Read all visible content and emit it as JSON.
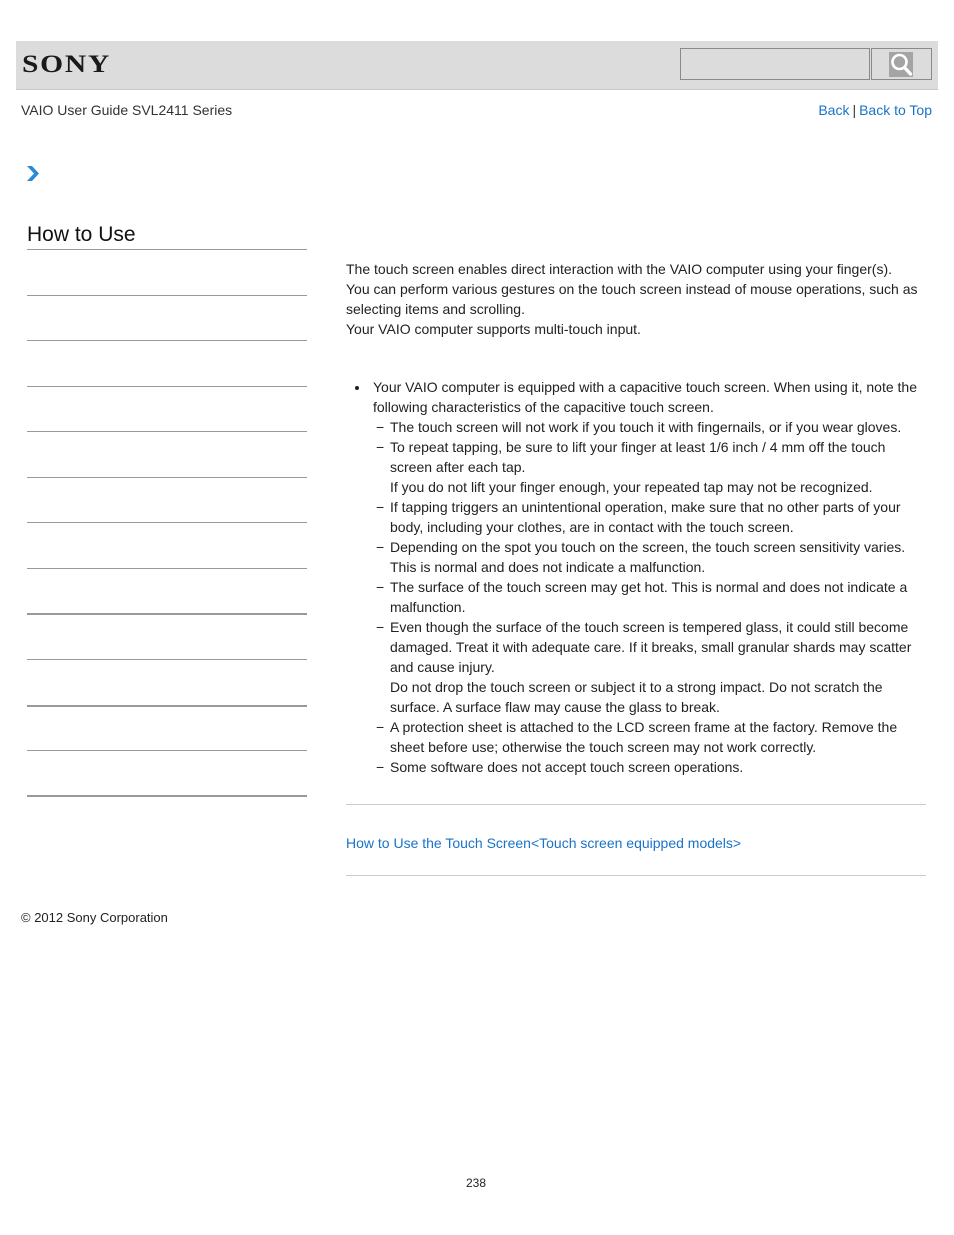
{
  "header": {
    "brand": "SONY",
    "search": {
      "value": "",
      "placeholder": ""
    },
    "search_icon": "magnifier-icon"
  },
  "subheader": {
    "guide_title": "VAIO User Guide SVL2411 Series",
    "back_label": "Back",
    "separator": "|",
    "back_to_top_label": "Back to Top"
  },
  "breadcrumb": {
    "icon": "chevron-right-icon",
    "accent": "#2a8ad4"
  },
  "sidebar": {
    "heading": "How to Use",
    "item_count": 12
  },
  "main": {
    "intro": [
      "The touch screen enables direct interaction with the VAIO computer using your finger(s).",
      "You can perform various gestures on the touch screen instead of mouse operations, such as selecting items and scrolling.",
      "Your VAIO computer supports multi-touch input."
    ],
    "notes": {
      "bullet": "Your VAIO computer is equipped with a capacitive touch screen. When using it, note the following characteristics of the capacitive touch screen.",
      "items": [
        {
          "text": "The touch screen will not work if you touch it with fingernails, or if you wear gloves.",
          "extra": ""
        },
        {
          "text": "To repeat tapping, be sure to lift your finger at least 1/6 inch / 4 mm off the touch screen after each tap.",
          "extra": "If you do not lift your finger enough, your repeated tap may not be recognized."
        },
        {
          "text": "If tapping triggers an unintentional operation, make sure that no other parts of your body, including your clothes, are in contact with the touch screen.",
          "extra": ""
        },
        {
          "text": "Depending on the spot you touch on the screen, the touch screen sensitivity varies. This is normal and does not indicate a malfunction.",
          "extra": ""
        },
        {
          "text": "The surface of the touch screen may get hot. This is normal and does not indicate a malfunction.",
          "extra": ""
        },
        {
          "text": "Even though the surface of the touch screen is tempered glass, it could still become damaged. Treat it with adequate care. If it breaks, small granular shards may scatter and cause injury.",
          "extra": "Do not drop the touch screen or subject it to a strong impact. Do not scratch the surface. A surface flaw may cause the glass to break."
        },
        {
          "text": "A protection sheet is attached to the LCD screen frame at the factory. Remove the sheet before use; otherwise the touch screen may not work correctly.",
          "extra": ""
        },
        {
          "text": "Some software does not accept touch screen operations.",
          "extra": ""
        }
      ]
    },
    "dash_glyph": "−",
    "related_link": "How to Use the Touch Screen<Touch screen equipped models>"
  },
  "footer": {
    "copyright": "© 2012 Sony Corporation",
    "page_number": "238"
  },
  "colors": {
    "link": "#1a73c8",
    "header_bg": "#dcdcdc",
    "divider": "#999999"
  }
}
